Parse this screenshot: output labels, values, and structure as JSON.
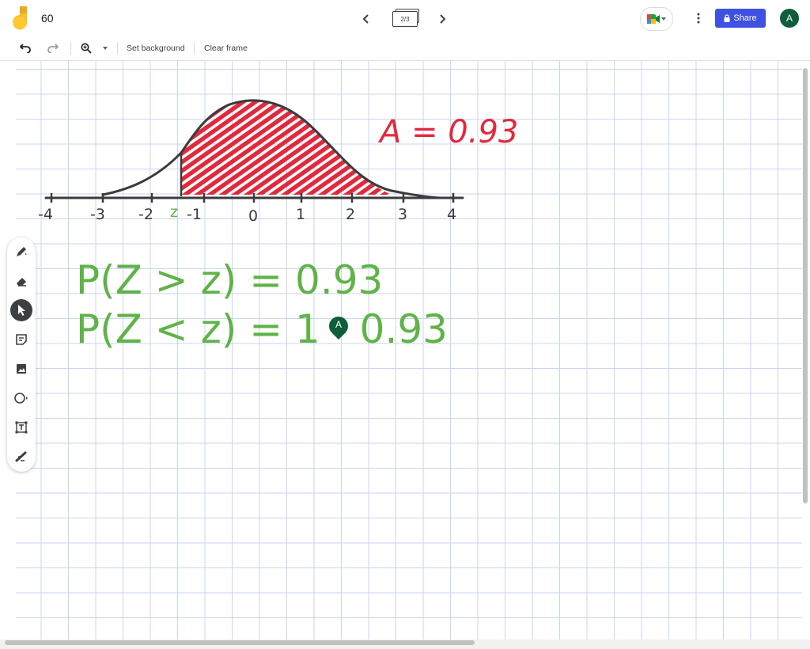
{
  "header": {
    "title": "60",
    "frame_indicator": "2/3",
    "share_label": "Share",
    "avatar_initial": "A"
  },
  "toolbar": {
    "set_background_label": "Set background",
    "clear_frame_label": "Clear frame"
  },
  "tools": [
    "pen-icon",
    "eraser-icon",
    "select-icon",
    "sticky-note-icon",
    "image-icon",
    "circle-icon",
    "text-box-icon",
    "laser-icon"
  ],
  "canvas": {
    "axis_ticks": [
      "-4",
      "-3",
      "-2",
      "z",
      "-1",
      "0",
      "1",
      "2",
      "3",
      "4"
    ],
    "area_label": "A = 0.93",
    "line1": "P(Z > z) = 0.93",
    "line2": "P(Z < z) = 1 - 0.93",
    "cursor_initial": "A"
  },
  "colors": {
    "accent": "#3f51e0",
    "avatar": "#0f5e3b",
    "ink_red": "#e02a3c",
    "ink_green": "#5fb347",
    "ink_dark": "#3b3b3b",
    "grid": "#c9d6ee"
  }
}
